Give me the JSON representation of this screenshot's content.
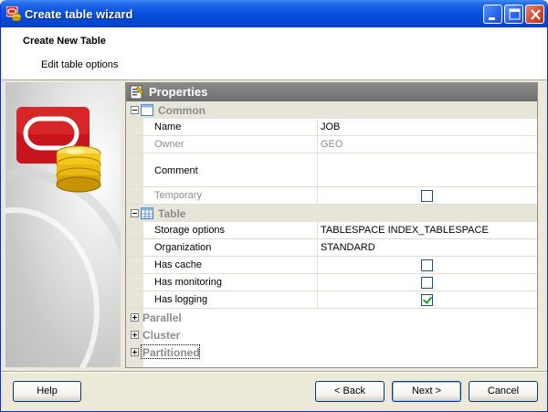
{
  "window": {
    "title": "Create table wizard",
    "min_icon": "minimize-icon",
    "max_icon": "maximize-icon",
    "close_icon": "close-icon"
  },
  "header": {
    "title": "Create New Table",
    "subtitle": "Edit table options"
  },
  "panel": {
    "title": "Properties",
    "icon": "properties-icon"
  },
  "categories": {
    "common": {
      "label": "Common",
      "rows": {
        "name": {
          "label": "Name",
          "value": "JOB"
        },
        "owner": {
          "label": "Owner",
          "value": "GEO"
        },
        "comment": {
          "label": "Comment",
          "value": ""
        },
        "temporary": {
          "label": "Temporary",
          "checked": false
        }
      }
    },
    "table": {
      "label": "Table",
      "rows": {
        "storage": {
          "label": "Storage options",
          "value": "TABLESPACE INDEX_TABLESPACE"
        },
        "organization": {
          "label": "Organization",
          "value": "STANDARD"
        },
        "cache": {
          "label": "Has cache",
          "checked": false
        },
        "monitoring": {
          "label": "Has monitoring",
          "checked": false
        },
        "logging": {
          "label": "Has logging",
          "checked": true
        }
      }
    },
    "parallel": {
      "label": "Parallel"
    },
    "cluster": {
      "label": "Cluster"
    },
    "partitioned": {
      "label": "Partitioned"
    }
  },
  "buttons": {
    "help": "Help",
    "back": "< Back",
    "next": "Next >",
    "cancel": "Cancel"
  },
  "colors": {
    "titlebar": "#0a56e2",
    "panel_header": "#7a7a7a",
    "category_text": "#8d8d8d",
    "check_mark": "#21a121"
  }
}
